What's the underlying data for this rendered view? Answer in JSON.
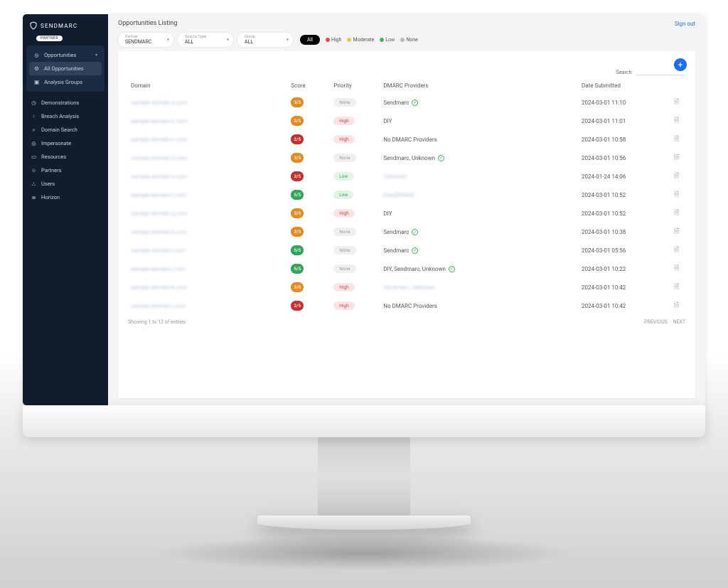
{
  "brand": {
    "name": "SENDMARC",
    "badge": "PARTNER"
  },
  "page_title": "Opportunities Listing",
  "signout": "Sign out",
  "sidebar": {
    "primary": {
      "label": "Opportunities",
      "children": [
        {
          "label": "All Opportunities",
          "active": true
        },
        {
          "label": "Analysis Groups"
        }
      ]
    },
    "items": [
      {
        "label": "Demonstrations",
        "icon": "clock-icon"
      },
      {
        "label": "Breach Analysis",
        "icon": "key-icon"
      },
      {
        "label": "Domain Search",
        "icon": "search-icon"
      },
      {
        "label": "Impersonate",
        "icon": "target-icon"
      },
      {
        "label": "Resources",
        "icon": "screen-icon"
      },
      {
        "label": "Partners",
        "icon": "smile-icon"
      },
      {
        "label": "Users",
        "icon": "users-icon"
      },
      {
        "label": "Horizon",
        "icon": "list-icon"
      }
    ]
  },
  "filters": {
    "partner": {
      "label": "Partner",
      "value": "SENDMARC"
    },
    "source_type": {
      "label": "Source Type",
      "value": "ALL"
    },
    "group": {
      "label": "Group",
      "value": "ALL"
    },
    "chips": {
      "all": "All",
      "high": "High",
      "moderate": "Moderate",
      "low": "Low",
      "none": "None"
    }
  },
  "search_label": "Search:",
  "columns": {
    "domain": "Domain",
    "score": "Score",
    "priority": "Priority",
    "providers": "DMARC Providers",
    "date": "Date Submitted"
  },
  "rows": [
    {
      "domain": "sample-domain-a.com",
      "score": "3/5",
      "score_color": "orange",
      "priority": "None",
      "priority_c": "none",
      "providers": "Sendmarc",
      "check": true,
      "date": "2024-03-01 11:10"
    },
    {
      "domain": "sample-domain-b.com",
      "score": "3/5",
      "score_color": "orange",
      "priority": "High",
      "priority_c": "high",
      "providers": "DIY",
      "check": false,
      "date": "2024-03-01 11:01"
    },
    {
      "domain": "sample-domain-c.com",
      "score": "2/5",
      "score_color": "red",
      "priority": "High",
      "priority_c": "high",
      "providers": "No DMARC Providers",
      "check": false,
      "date": "2024-03-01 10:58"
    },
    {
      "domain": "sample-domain-d.com",
      "score": "3/5",
      "score_color": "orange",
      "priority": "None",
      "priority_c": "none",
      "providers": "Sendmarc, Unknown",
      "check": true,
      "date": "2024-03-01 10:56"
    },
    {
      "domain": "sample-domain-e.com",
      "score": "2/5",
      "score_color": "red",
      "priority": "Low",
      "priority_c": "low",
      "providers": "Unknown",
      "check": false,
      "blur_prov": true,
      "date": "2024-01-24 14:06"
    },
    {
      "domain": "sample-domain-f.com",
      "score": "5/5",
      "score_color": "green",
      "priority": "Low",
      "priority_c": "low",
      "providers": "EasyDMARC",
      "check": false,
      "blur_prov": true,
      "date": "2024-03-01 10:52"
    },
    {
      "domain": "sample-domain-g.com",
      "score": "3/5",
      "score_color": "orange",
      "priority": "High",
      "priority_c": "high",
      "providers": "DIY",
      "check": false,
      "date": "2024-03-01 10:52"
    },
    {
      "domain": "sample-domain-h.com",
      "score": "3/5",
      "score_color": "orange",
      "priority": "None",
      "priority_c": "none",
      "providers": "Sendmarc",
      "check": true,
      "date": "2024-03-01 10:38"
    },
    {
      "domain": "sample-domain-i.com",
      "score": "5/5",
      "score_color": "green",
      "priority": "None",
      "priority_c": "none",
      "providers": "Sendmarc",
      "check": true,
      "date": "2024-03-01 05:56"
    },
    {
      "domain": "sample-domain-j.com",
      "score": "5/5",
      "score_color": "green",
      "priority": "None",
      "priority_c": "none",
      "providers": "DIY, Sendmarc, Unknown",
      "check": true,
      "date": "2024-03-01 10:22"
    },
    {
      "domain": "sample-domain-k.com",
      "score": "3/5",
      "score_color": "orange",
      "priority": "High",
      "priority_c": "high",
      "providers": "Sendmarc, Unknown",
      "check": false,
      "blur_prov": true,
      "date": "2024-03-01 10:42"
    },
    {
      "domain": "sample-domain-l.com",
      "score": "2/5",
      "score_color": "red",
      "priority": "High",
      "priority_c": "high",
      "providers": "No DMARC Providers",
      "check": false,
      "date": "2024-03-01 10:42"
    }
  ],
  "footer": {
    "showing": "Showing 1 to 12 of entries",
    "prev": "PREVIOUS",
    "next": "NEXT"
  }
}
